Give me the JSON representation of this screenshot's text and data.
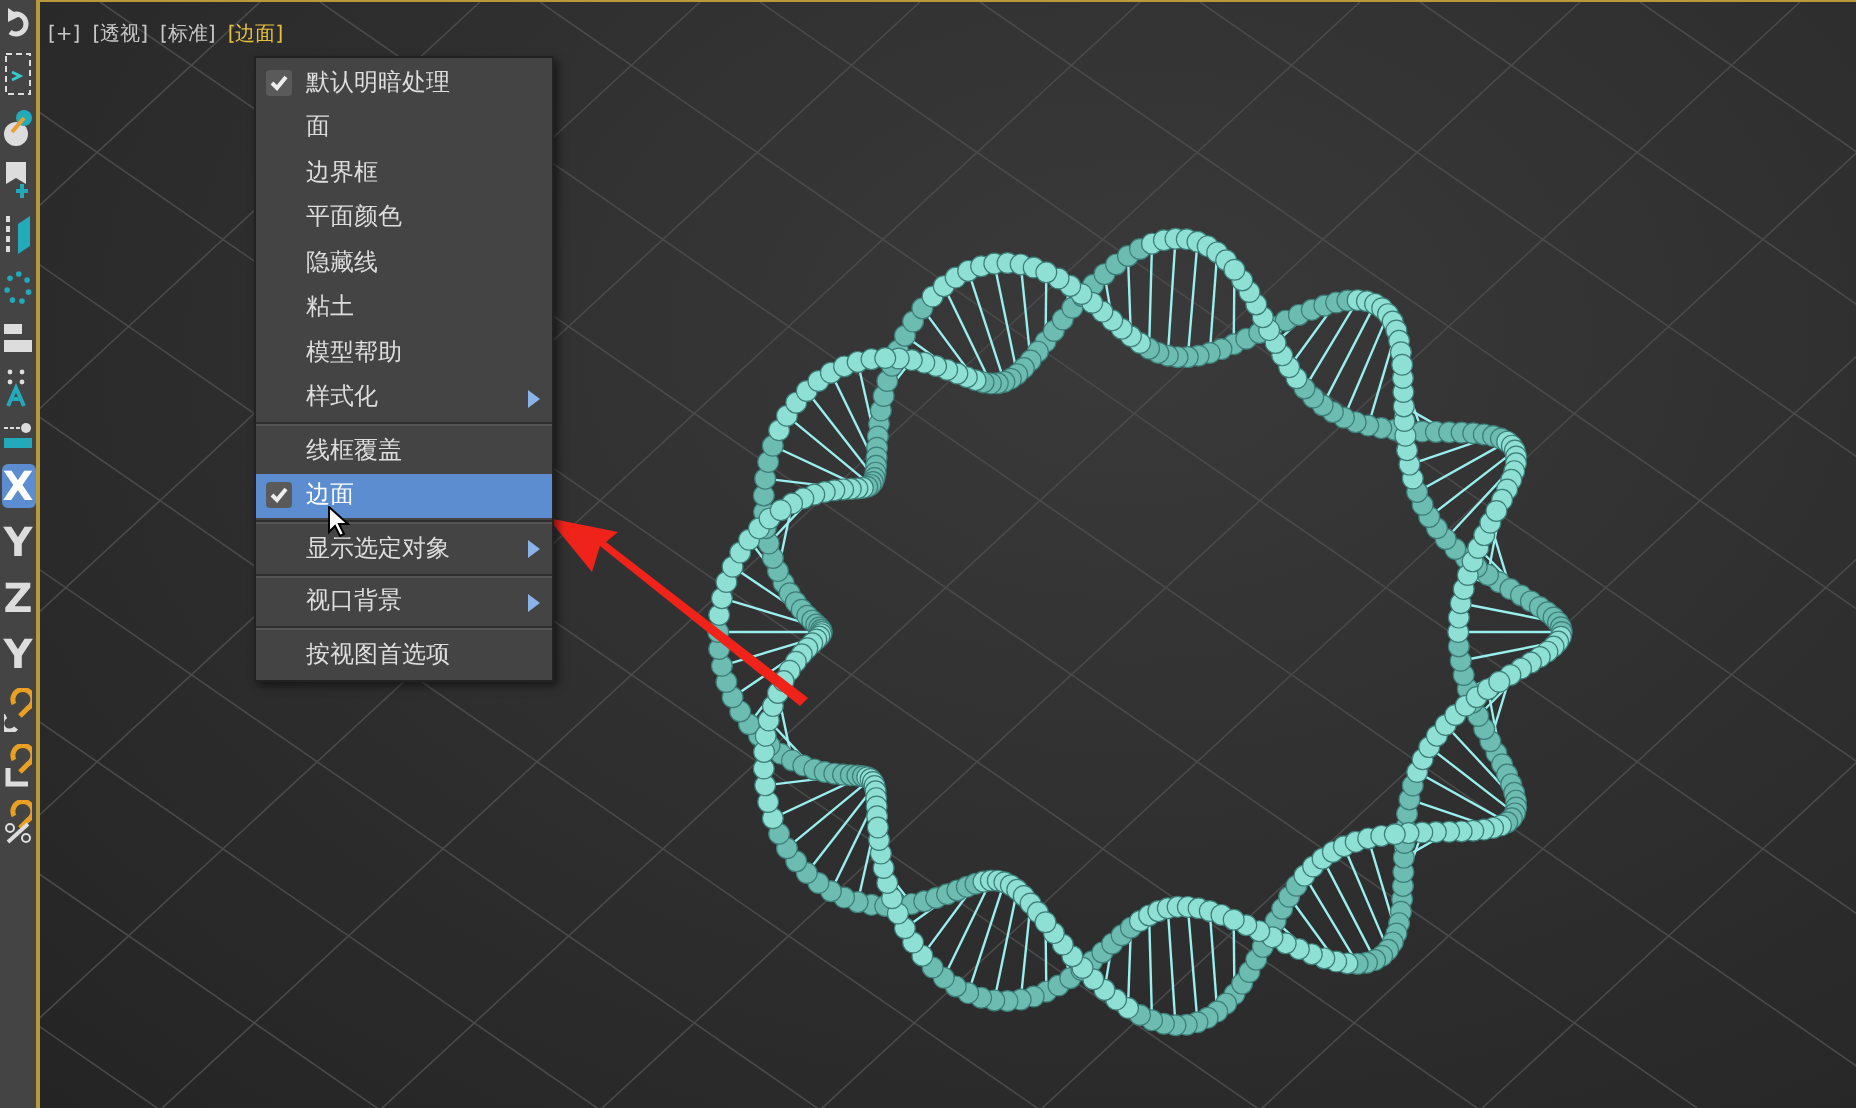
{
  "viewport_labels": [
    {
      "text": "[+]",
      "selected": false
    },
    {
      "text": "[透视]",
      "selected": false
    },
    {
      "text": "[标准]",
      "selected": false
    },
    {
      "text": "[边面]",
      "selected": true
    }
  ],
  "toolbar": {
    "axis_buttons": [
      {
        "label": "X",
        "selected": true
      },
      {
        "label": "Y",
        "selected": false
      },
      {
        "label": "Z",
        "selected": false
      },
      {
        "label": "Y",
        "selected": false
      }
    ]
  },
  "menu": {
    "groups": [
      {
        "items": [
          {
            "label": "默认明暗处理",
            "checked": true,
            "submenu": false,
            "selected": false
          },
          {
            "label": "面",
            "checked": false,
            "submenu": false,
            "selected": false
          },
          {
            "label": "边界框",
            "checked": false,
            "submenu": false,
            "selected": false
          },
          {
            "label": "平面颜色",
            "checked": false,
            "submenu": false,
            "selected": false
          },
          {
            "label": "隐藏线",
            "checked": false,
            "submenu": false,
            "selected": false
          },
          {
            "label": "粘土",
            "checked": false,
            "submenu": false,
            "selected": false
          },
          {
            "label": "模型帮助",
            "checked": false,
            "submenu": false,
            "selected": false
          },
          {
            "label": "样式化",
            "checked": false,
            "submenu": true,
            "selected": false
          }
        ]
      },
      {
        "items": [
          {
            "label": "线框覆盖",
            "checked": false,
            "submenu": false,
            "selected": false
          },
          {
            "label": "边面",
            "checked": true,
            "submenu": false,
            "selected": true
          }
        ]
      },
      {
        "items": [
          {
            "label": "显示选定对象",
            "checked": false,
            "submenu": true,
            "selected": false
          }
        ]
      },
      {
        "items": [
          {
            "label": "视口背景",
            "checked": false,
            "submenu": true,
            "selected": false
          }
        ]
      },
      {
        "items": [
          {
            "label": "按视图首选项",
            "checked": false,
            "submenu": false,
            "selected": false
          }
        ]
      }
    ]
  }
}
